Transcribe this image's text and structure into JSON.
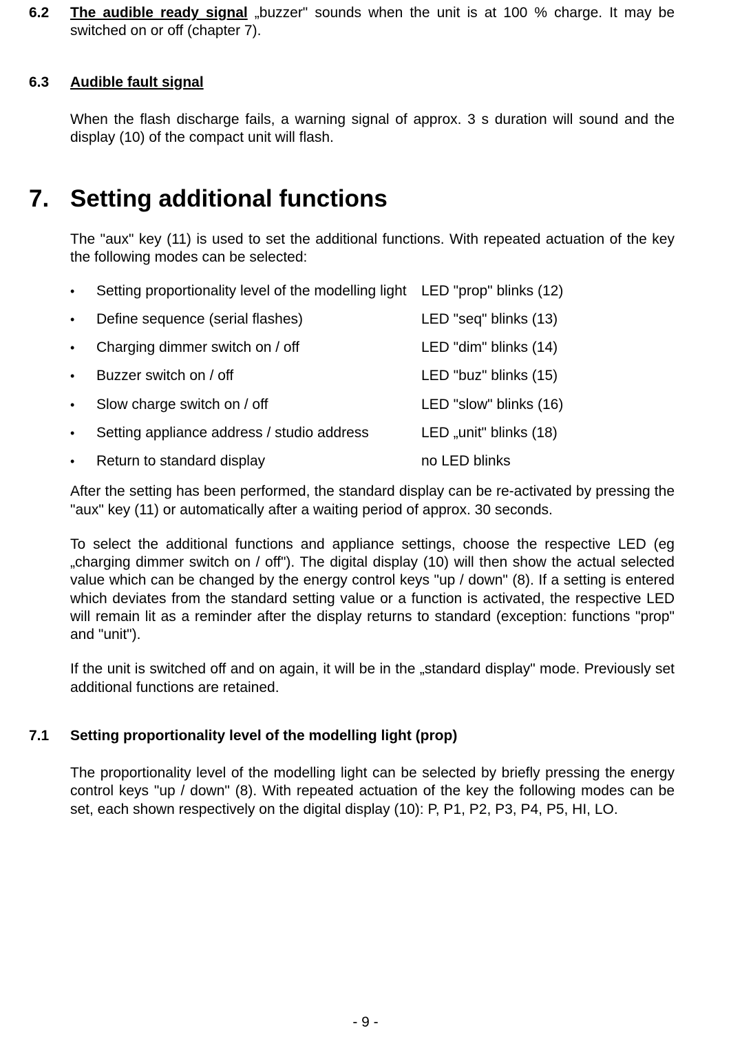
{
  "section62": {
    "num": "6.2",
    "title": "The audible ready signal",
    "body": " „buzzer\" sounds when the unit is at 100 % charge. It may be switched on or off (chapter 7)."
  },
  "section63": {
    "num": "6.3",
    "title": "Audible fault signal",
    "body": "When the flash discharge fails, a warning signal of approx. 3 s duration will sound and the display (10) of the compact unit will flash."
  },
  "chapter7": {
    "num": "7.",
    "title": "Setting additional functions",
    "intro": "The \"aux\" key (11) is used to set the additional functions. With repeated actuation of the key the following modes can be selected:",
    "bullets": [
      {
        "label": "Setting proportionality level of the modelling light",
        "value": "LED \"prop\" blinks (12)"
      },
      {
        "label": "Define sequence (serial flashes)",
        "value": "LED \"seq\" blinks (13)"
      },
      {
        "label": "Charging dimmer switch on / off",
        "value": "LED \"dim\" blinks (14)"
      },
      {
        "label": "Buzzer switch on / off",
        "value": "LED \"buz\" blinks (15)"
      },
      {
        "label": "Slow charge switch on / off",
        "value": "LED \"slow\" blinks (16)"
      },
      {
        "label": "Setting appliance address / studio address",
        "value": "LED „unit\" blinks (18)"
      },
      {
        "label": "Return to standard display",
        "value": "no LED blinks"
      }
    ],
    "para1": "After the setting has been performed, the standard display can be re-activated by pressing the \"aux\" key (11) or automatically after a waiting period of approx. 30 seconds.",
    "para2": "To select the additional functions and appliance settings, choose the respective LED (eg „charging dimmer switch on / off\"). The digital display (10) will then show the actual selected value which can be changed by the energy control keys \"up / down\" (8). If a setting is entered which deviates from the standard setting value or a function is activated, the respective LED will remain lit as a reminder after the display returns to standard (exception: functions \"prop\" and \"unit\").",
    "para3": "If the unit is switched off and on again, it will be in the „standard display\" mode. Previously set additional functions are retained."
  },
  "section71": {
    "num": "7.1",
    "title": "Setting proportionality level of the modelling light (prop)",
    "body": "The proportionality level of the modelling light can be selected by briefly pressing the energy control keys \"up / down\" (8). With repeated actuation of the key the following modes can be set, each shown respectively on the digital display (10): P, P1, P2, P3, P4, P5, HI, LO."
  },
  "pageNum": "- 9 -"
}
